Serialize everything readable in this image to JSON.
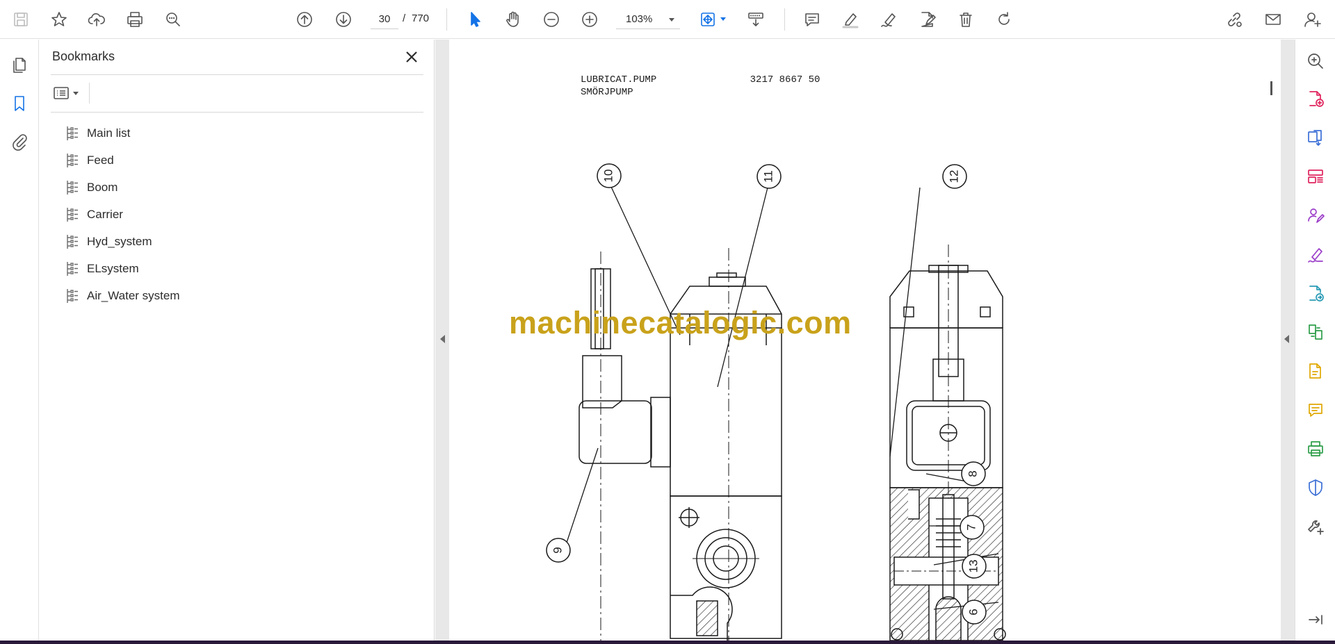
{
  "toolbar": {
    "page_current": "30",
    "page_separator": "/",
    "page_total": "770",
    "zoom": "103%"
  },
  "bookmarks": {
    "title": "Bookmarks",
    "items": [
      {
        "label": "Main list"
      },
      {
        "label": "Feed"
      },
      {
        "label": "Boom"
      },
      {
        "label": "Carrier"
      },
      {
        "label": "Hyd_system"
      },
      {
        "label": "ELsystem"
      },
      {
        "label": "Air_Water system"
      }
    ]
  },
  "document": {
    "header_line1": "LUBRICAT.PUMP                3217 8667 50",
    "header_line2": "SMÖRJPUMP",
    "watermark": "machinecatalogic.com",
    "callouts": [
      "10",
      "11",
      "12",
      "9",
      "8",
      "7",
      "13",
      "6"
    ]
  },
  "colors": {
    "accent": "#1473e6",
    "watermark": "#c9a21b",
    "rail_red": "#e0245e",
    "rail_purple": "#9b3cc9",
    "rail_green": "#2e9e4a",
    "rail_yellow": "#e0a800",
    "rail_blue": "#3b6fd6"
  }
}
